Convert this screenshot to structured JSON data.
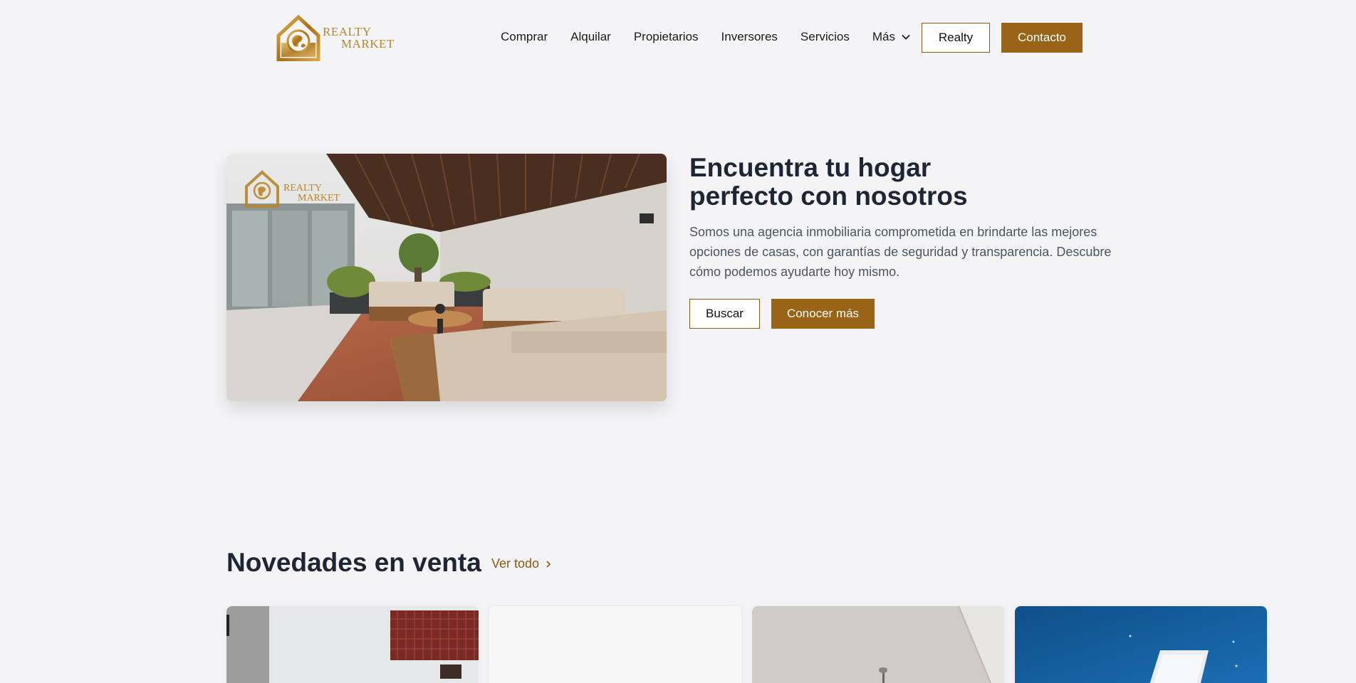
{
  "brand": {
    "logo_line1": "REALTY",
    "logo_line2": "MARKET",
    "accent_color": "#9a6416"
  },
  "nav": {
    "items": [
      {
        "label": "Comprar"
      },
      {
        "label": "Alquilar"
      },
      {
        "label": "Propietarios"
      },
      {
        "label": "Inversores"
      },
      {
        "label": "Servicios"
      },
      {
        "label": "Más",
        "icon": "chevron-down-icon"
      }
    ],
    "realty_button": "Realty",
    "contact_button": "Contacto"
  },
  "hero": {
    "title": "Encuentra tu hogar perfecto con nosotros",
    "description": "Somos una agencia inmobiliaria comprometida en brindarte las mejores opciones de casas, con garantías de seguridad y transparencia. Descubre cómo podemos ayudarte hoy mismo.",
    "search_button": "Buscar",
    "learn_more_button": "Conocer más",
    "image_watermark_line1": "REALTY",
    "image_watermark_line2": "MARKET"
  },
  "listings": {
    "title": "Novedades en venta",
    "see_all": "Ver todo"
  }
}
